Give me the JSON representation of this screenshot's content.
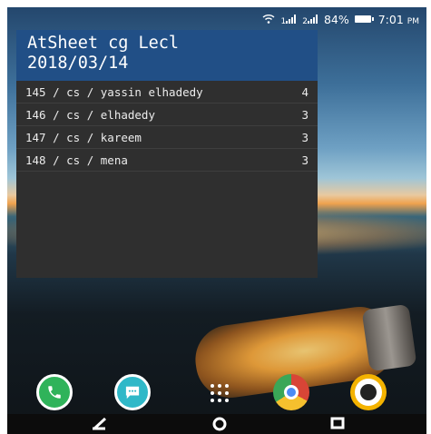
{
  "status_bar": {
    "signal1": "1",
    "signal2": "2",
    "battery": "84%",
    "time": "7:01",
    "ampm": "PM"
  },
  "widget": {
    "title_line1": "AtSheet cg Lecl",
    "title_line2": "2018/03/14",
    "rows": [
      {
        "text": "145 / cs /  yassin elhadedy",
        "count": "4"
      },
      {
        "text": "146 / cs /   elhadedy",
        "count": "3"
      },
      {
        "text": "147 / cs /   kareem",
        "count": "3"
      },
      {
        "text": "148 / cs /   mena",
        "count": "3"
      }
    ]
  },
  "dock": {
    "apps": [
      "phone-icon",
      "messages-icon",
      "app-drawer-icon",
      "chrome-icon",
      "camera-icon"
    ]
  },
  "nav": {
    "back": "back-icon",
    "home": "home-icon",
    "recents": "recents-icon"
  }
}
